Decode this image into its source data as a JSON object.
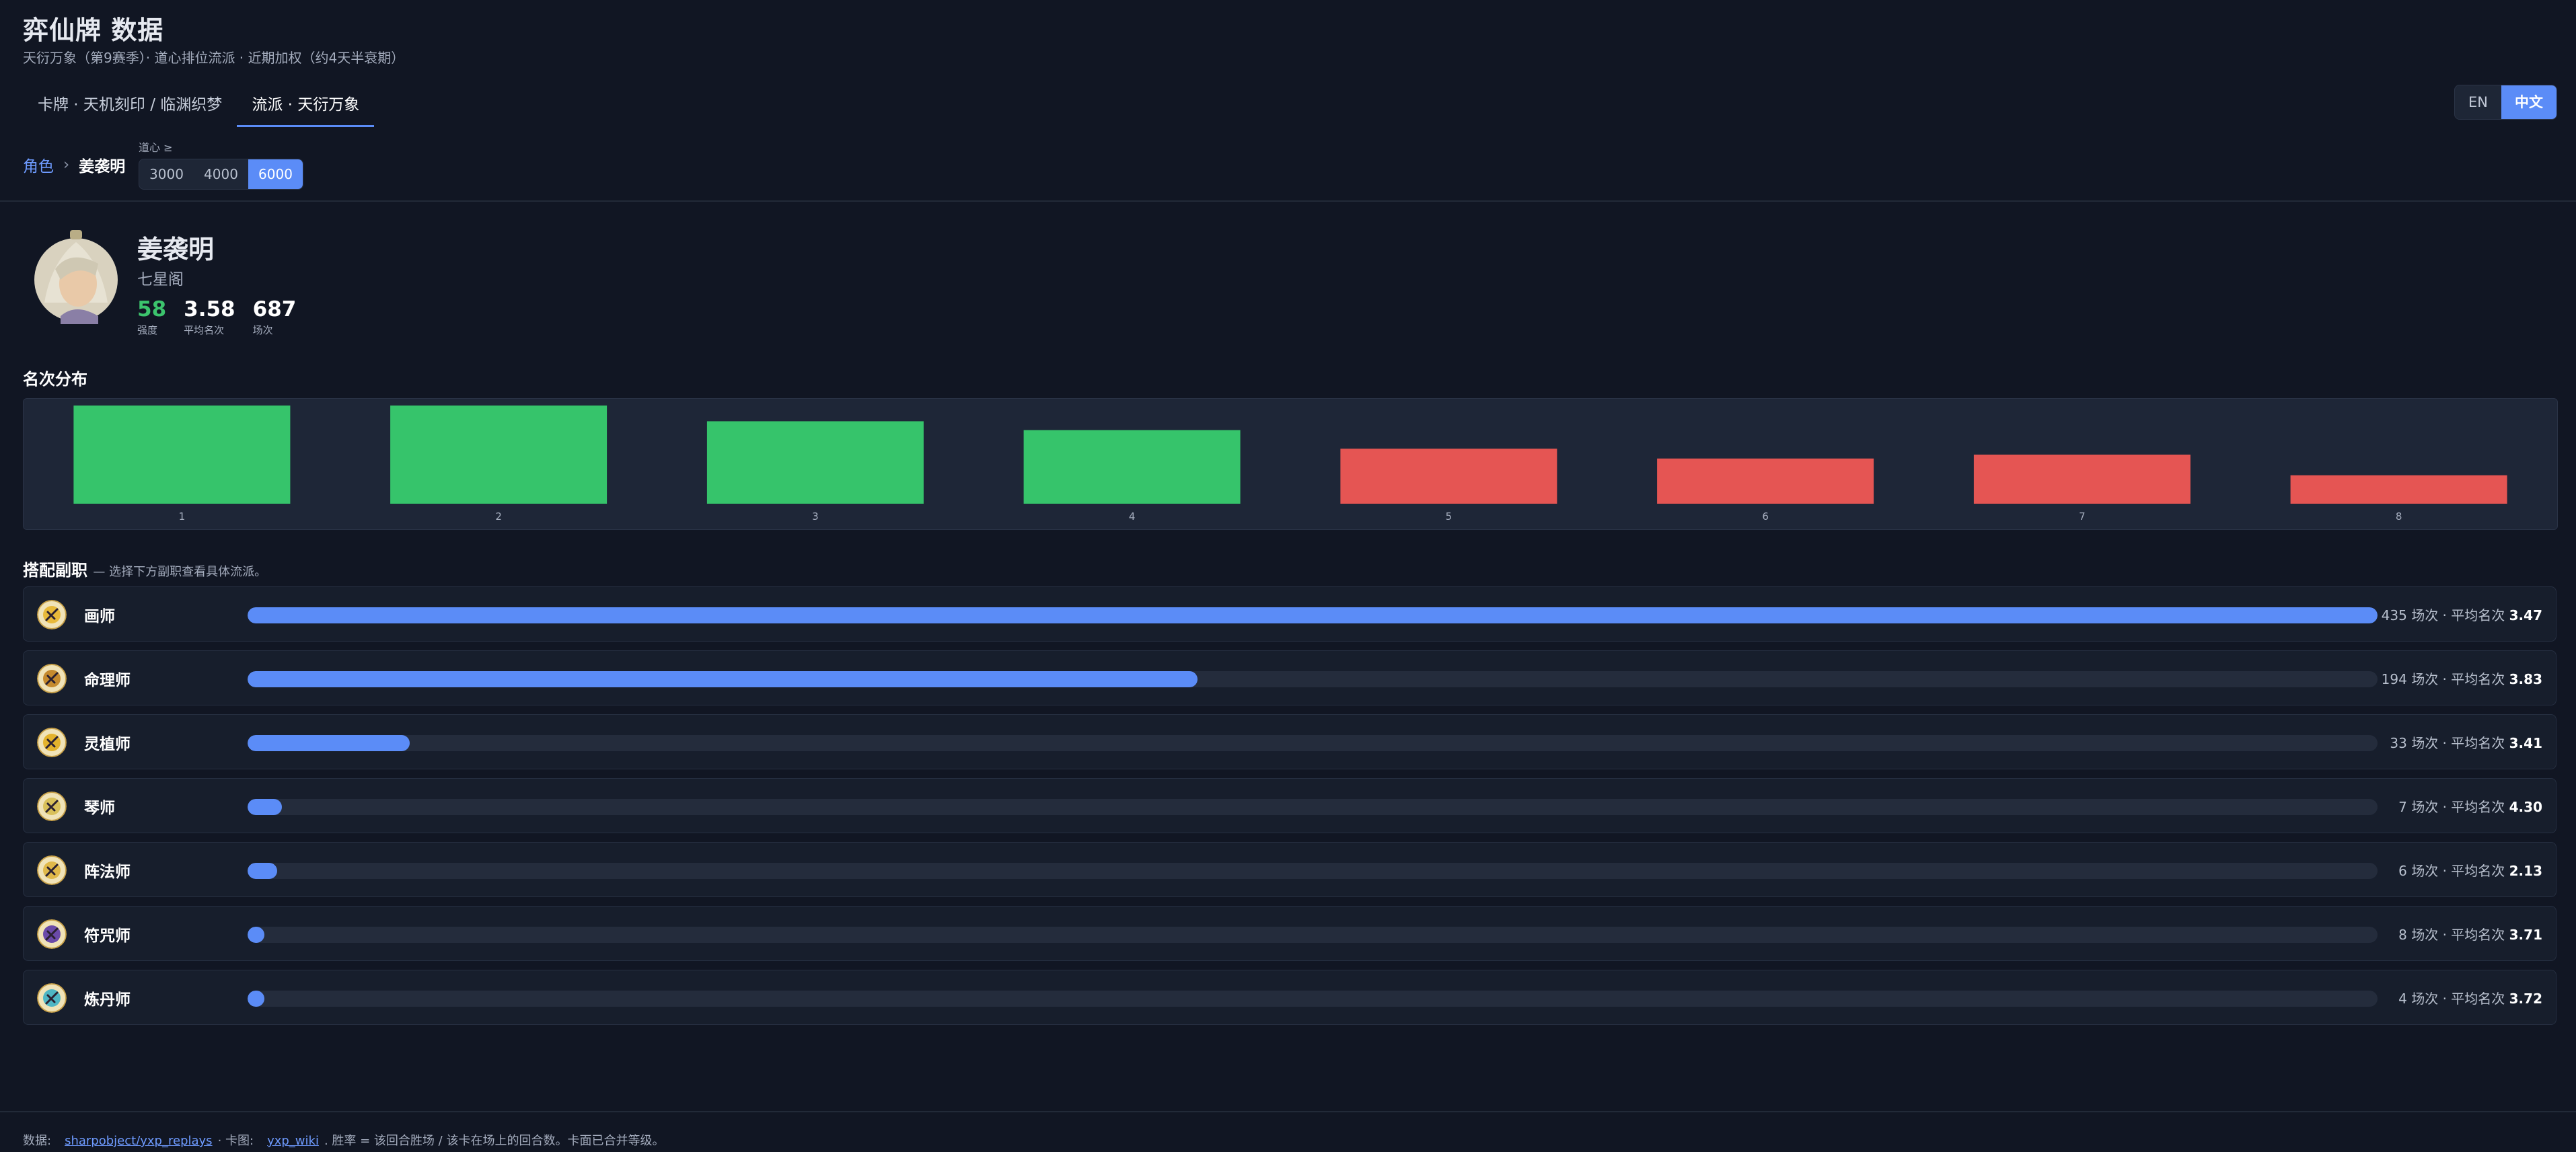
{
  "header": {
    "title": "弈仙牌 数据",
    "subtitle": "天衍万象（第9赛季）· 道心排位流派 · 近期加权（约4天半衰期）",
    "tabs": [
      {
        "label": "卡牌 · 天机刻印 / 临渊织梦",
        "active": false
      },
      {
        "label": "流派 · 天衍万象",
        "active": true
      }
    ],
    "lang": [
      {
        "label": "EN",
        "active": false
      },
      {
        "label": "中文",
        "active": true
      }
    ],
    "breadcrumb": {
      "root": "角色",
      "sep": "›",
      "current": "姜袭明"
    },
    "dao_filter": {
      "label": "道心 ≥",
      "options": [
        {
          "label": "3000",
          "active": false
        },
        {
          "label": "4000",
          "active": false
        },
        {
          "label": "6000",
          "active": true
        }
      ]
    }
  },
  "profile": {
    "name": "姜袭明",
    "sect": "七星阁",
    "stats": [
      {
        "value": "58",
        "label": "强度",
        "color": "#3cc46d"
      },
      {
        "value": "3.58",
        "label": "平均名次"
      },
      {
        "value": "687",
        "label": "场次"
      }
    ]
  },
  "placement": {
    "title": "名次分布"
  },
  "chart_data": {
    "type": "bar",
    "categories": [
      "1",
      "2",
      "3",
      "4",
      "5",
      "6",
      "7",
      "8"
    ],
    "values": [
      1.0,
      1.0,
      0.84,
      0.75,
      0.56,
      0.46,
      0.5,
      0.29
    ],
    "colors": [
      "#36c46b",
      "#36c46b",
      "#36c46b",
      "#36c46b",
      "#e55553",
      "#e55553",
      "#e55553",
      "#e55553"
    ],
    "title": "名次分布",
    "grid": false
  },
  "professions": {
    "title": "搭配副职",
    "note": "— 选择下方副职查看具体流派。",
    "items": [
      {
        "name": "画师",
        "count_text": "435 场次 · 平均名次",
        "avg": "3.47",
        "share": 1.0,
        "icon": "painter-icon",
        "icon_color": "#e8b93a"
      },
      {
        "name": "命理师",
        "count_text": "194 场次 · 平均名次",
        "avg": "3.83",
        "share": 0.446,
        "icon": "fortune-teller-icon",
        "icon_color": "#c58a2e"
      },
      {
        "name": "灵植师",
        "count_text": "33 场次 · 平均名次",
        "avg": "3.41",
        "share": 0.076,
        "icon": "botanist-icon",
        "icon_color": "#e3b22c"
      },
      {
        "name": "琴师",
        "count_text": "7 场次 · 平均名次",
        "avg": "4.30",
        "share": 0.016,
        "icon": "musician-icon",
        "icon_color": "#d9c05a"
      },
      {
        "name": "阵法师",
        "count_text": "6 场次 · 平均名次",
        "avg": "2.13",
        "share": 0.014,
        "icon": "formation-master-icon",
        "icon_color": "#e0b84a"
      },
      {
        "name": "符咒师",
        "count_text": "8 场次 · 平均名次",
        "avg": "3.71",
        "share": 0.008,
        "icon": "talisman-icon",
        "icon_color": "#6b4aa8"
      },
      {
        "name": "炼丹师",
        "count_text": "4 场次 · 平均名次",
        "avg": "3.72",
        "share": 0.008,
        "icon": "alchemist-icon",
        "icon_color": "#4fb6c4"
      }
    ]
  },
  "footer": {
    "prefix": "数据:",
    "link1": "sharpobject/yxp_replays",
    "mid": "· 卡图:",
    "link2": "yxp_wiki",
    "suffix": ". 胜率 = 该回合胜场 / 该卡在场上的回合数。卡面已合并等级。"
  }
}
